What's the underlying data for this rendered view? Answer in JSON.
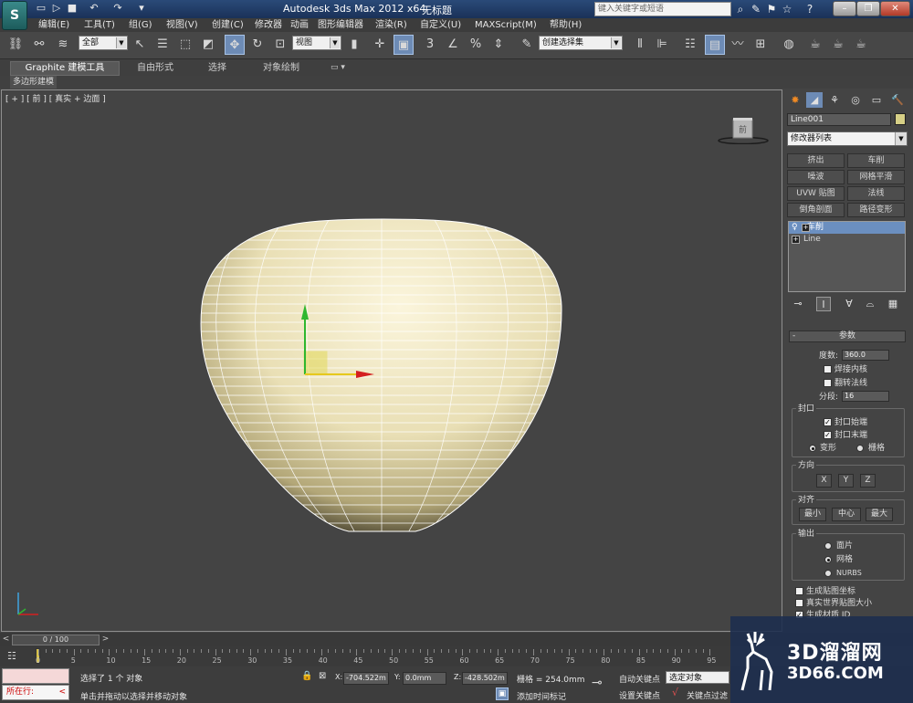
{
  "window": {
    "app_title": "Autodesk 3ds Max  2012 x64",
    "doc_title": "无标题",
    "search_placeholder": "键入关键字或短语"
  },
  "menu": [
    "编辑(E)",
    "工具(T)",
    "组(G)",
    "视图(V)",
    "创建(C)",
    "修改器",
    "动画",
    "图形编辑器",
    "渲染(R)",
    "自定义(U)",
    "MAXScript(M)",
    "帮助(H)"
  ],
  "toolbar": {
    "selection_filter": "全部",
    "ref_coord": "视图",
    "named_selection": "创建选择集"
  },
  "ribbon": {
    "tabs": [
      "Graphite 建模工具",
      "自由形式",
      "选择",
      "对象绘制"
    ],
    "panel_label": "多边形建模"
  },
  "viewport": {
    "label": "[ + ] [ 前 ] [ 真实 + 边面 ]",
    "viewcube_label": "前"
  },
  "command_panel": {
    "object_name": "Line001",
    "object_color": "#d6cf86",
    "modifier_list": "修改器列表",
    "modifier_buttons": [
      "挤出",
      "车削",
      "噪波",
      "网格平滑",
      "UVW 贴图",
      "法线",
      "倒角剖面",
      "路径变形"
    ],
    "stack": [
      "车削",
      "Line"
    ],
    "rollout_title": "参数",
    "degrees_label": "度数:",
    "degrees_value": "360.0",
    "weld_core": "焊接内核",
    "flip_normals": "翻转法线",
    "segments_label": "分段:",
    "segments_value": "16",
    "capping_group": "封口",
    "cap_start": "封口始端",
    "cap_end": "封口末端",
    "morph": "变形",
    "grid": "栅格",
    "direction_group": "方向",
    "axes": [
      "X",
      "Y",
      "Z"
    ],
    "align_group": "对齐",
    "align_buttons": [
      "最小",
      "中心",
      "最大"
    ],
    "output_group": "输出",
    "output_options": [
      "面片",
      "网格",
      "NURBS"
    ],
    "gen_mapping": "生成贴图坐标",
    "real_world": "真实世界贴图大小",
    "gen_mat_ids": "生成材质 ID"
  },
  "timeline": {
    "slider": "0 / 100",
    "ticks": [
      "0",
      "5",
      "10",
      "15",
      "20",
      "25",
      "30",
      "35",
      "40",
      "45",
      "50",
      "55",
      "60",
      "65",
      "70",
      "75",
      "80",
      "85",
      "90",
      "95"
    ]
  },
  "status": {
    "running_label": "所在行:",
    "selected_text": "选择了 1 个 对象",
    "prompt_text": "单击并拖动以选择并移动对象",
    "x_label": "X:",
    "x_value": "-704.522m",
    "y_label": "Y:",
    "y_value": "0.0mm",
    "z_label": "Z:",
    "z_value": "-428.502m",
    "grid_text": "栅格 = 254.0mm",
    "add_time_tag": "添加时间标记",
    "auto_key": "自动关键点",
    "selected_dropdown": "选定对象",
    "set_key": "设置关键点",
    "key_filter": "关键点过滤"
  },
  "watermark": {
    "text": "3D溜溜网",
    "url": "3D66.COM"
  }
}
